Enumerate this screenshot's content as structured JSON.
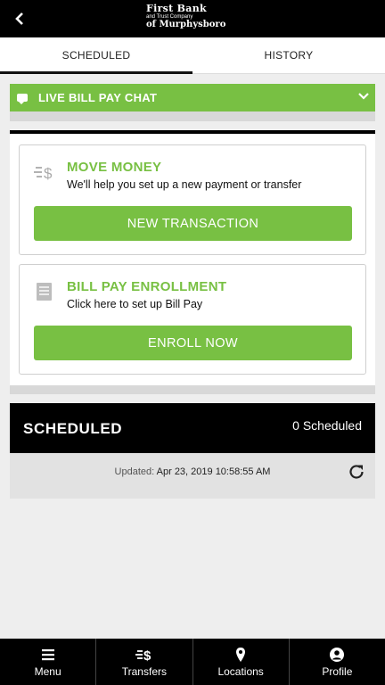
{
  "header": {
    "logo_line1": "First Bank",
    "logo_line2": "and Trust Company",
    "logo_line3": "of Murphysboro"
  },
  "tabs": [
    {
      "label": "SCHEDULED",
      "active": true
    },
    {
      "label": "HISTORY",
      "active": false
    }
  ],
  "chat": {
    "label": "LIVE BILL PAY CHAT"
  },
  "move_money": {
    "title": "MOVE MONEY",
    "subtitle": "We'll help you set up a new payment or transfer",
    "button": "NEW TRANSACTION"
  },
  "enrollment": {
    "title": "BILL PAY ENROLLMENT",
    "subtitle": "Click here to set up Bill Pay",
    "button": "ENROLL NOW"
  },
  "scheduled": {
    "title": "SCHEDULED",
    "count": "0 Scheduled",
    "updated_label": "Updated:",
    "updated_value": "Apr 23, 2019 10:58:55 AM"
  },
  "nav": [
    {
      "label": "Menu",
      "icon": "menu-icon"
    },
    {
      "label": "Transfers",
      "icon": "transfers-icon"
    },
    {
      "label": "Locations",
      "icon": "location-pin-icon"
    },
    {
      "label": "Profile",
      "icon": "profile-icon"
    }
  ],
  "colors": {
    "accent": "#78c043",
    "bar": "#000000",
    "background": "#eeeeee"
  }
}
